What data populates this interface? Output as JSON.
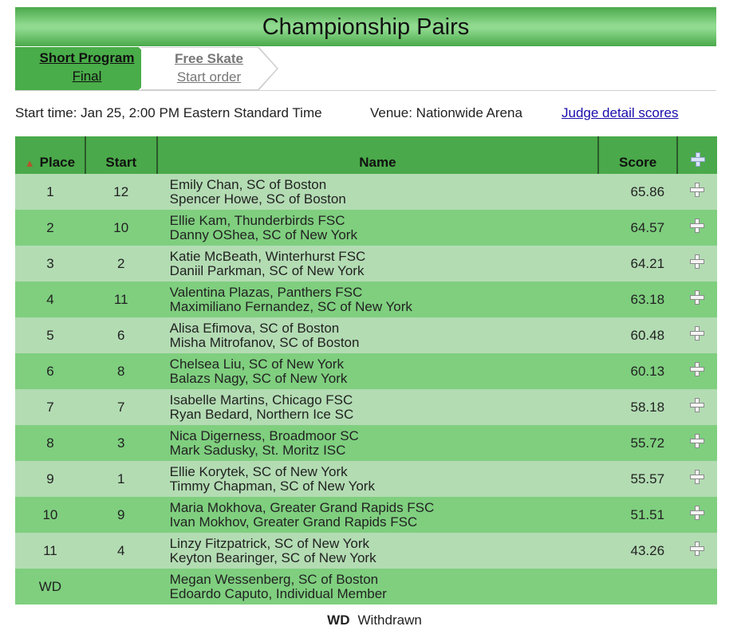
{
  "title": "Championship Pairs",
  "tabs": [
    {
      "line1": "Short Program",
      "line2": "Final"
    },
    {
      "line1": "Free Skate",
      "line2": "Start order"
    }
  ],
  "info": {
    "start_time": "Start time: Jan 25, 2:00 PM Eastern Standard Time",
    "venue": "Venue: Nationwide Arena",
    "judge_link": "Judge detail scores"
  },
  "table": {
    "headers": {
      "place": "Place",
      "start": "Start",
      "name": "Name",
      "score": "Score"
    },
    "rows": [
      {
        "place": "1",
        "start": "12",
        "name1": "Emily Chan, SC of Boston",
        "name2": "Spencer Howe, SC of Boston",
        "score": "65.86"
      },
      {
        "place": "2",
        "start": "10",
        "name1": "Ellie Kam, Thunderbirds FSC",
        "name2": "Danny OShea, SC of New York",
        "score": "64.57"
      },
      {
        "place": "3",
        "start": "2",
        "name1": "Katie McBeath, Winterhurst FSC",
        "name2": "Daniil Parkman, SC of New York",
        "score": "64.21"
      },
      {
        "place": "4",
        "start": "11",
        "name1": "Valentina Plazas, Panthers FSC",
        "name2": "Maximiliano Fernandez, SC of New York",
        "score": "63.18"
      },
      {
        "place": "5",
        "start": "6",
        "name1": "Alisa Efimova, SC of Boston",
        "name2": "Misha Mitrofanov, SC of Boston",
        "score": "60.48"
      },
      {
        "place": "6",
        "start": "8",
        "name1": "Chelsea Liu, SC of New York",
        "name2": "Balazs Nagy, SC of New York",
        "score": "60.13"
      },
      {
        "place": "7",
        "start": "7",
        "name1": "Isabelle Martins, Chicago FSC",
        "name2": "Ryan Bedard, Northern Ice SC",
        "score": "58.18"
      },
      {
        "place": "8",
        "start": "3",
        "name1": "Nica Digerness, Broadmoor SC",
        "name2": "Mark Sadusky, St. Moritz ISC",
        "score": "55.72"
      },
      {
        "place": "9",
        "start": "1",
        "name1": "Ellie Korytek, SC of New York",
        "name2": "Timmy Chapman, SC of New York",
        "score": "55.57"
      },
      {
        "place": "10",
        "start": "9",
        "name1": "Maria Mokhova, Greater Grand Rapids FSC",
        "name2": "Ivan Mokhov, Greater Grand Rapids FSC",
        "score": "51.51"
      },
      {
        "place": "11",
        "start": "4",
        "name1": "Linzy Fitzpatrick, SC of New York",
        "name2": "Keyton Bearinger, SC of New York",
        "score": "43.26"
      },
      {
        "place": "WD",
        "start": "",
        "name1": "Megan Wessenberg, SC of Boston",
        "name2": "Edoardo Caputo, Individual Member",
        "score": ""
      }
    ]
  },
  "legend": {
    "abbr": "WD",
    "meaning": "Withdrawn"
  }
}
